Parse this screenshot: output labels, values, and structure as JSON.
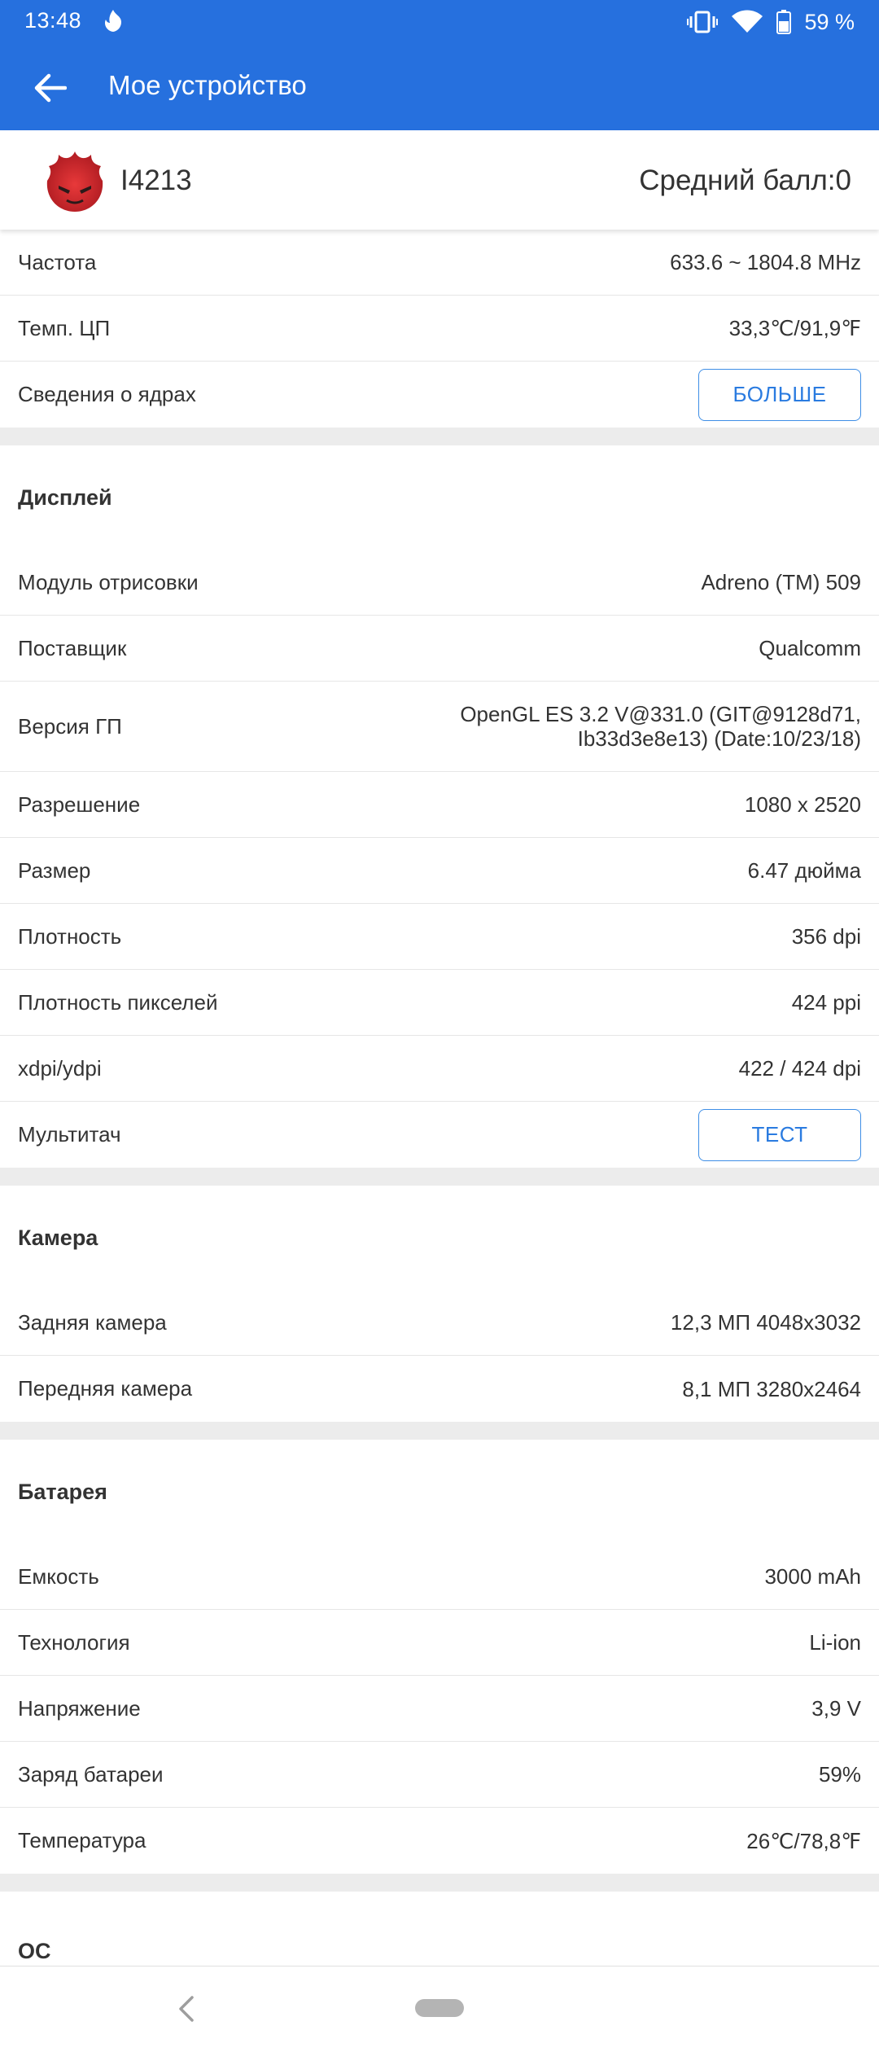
{
  "status_bar": {
    "time": "13:48",
    "battery_percent": "59 %",
    "icons": [
      "vibrate-icon",
      "wifi-icon",
      "battery-icon"
    ]
  },
  "app_bar": {
    "title": "Мое устройство",
    "back_icon": "arrow-back-icon"
  },
  "device": {
    "name": "I4213",
    "score": "Средний балл:0",
    "logo_icon": "antutu-logo-icon"
  },
  "cpu_rows": [
    {
      "label": "Частота",
      "value": "633.6 ~ 1804.8 MHz"
    },
    {
      "label": "Темп. ЦП",
      "value": "33,3℃/91,9℉"
    },
    {
      "label": "Сведения о ядрах",
      "button": "БОЛЬШЕ"
    }
  ],
  "display": {
    "title": "Дисплей",
    "rows": [
      {
        "label": "Модуль отрисовки",
        "value": "Adreno (TM) 509"
      },
      {
        "label": "Поставщик",
        "value": "Qualcomm"
      },
      {
        "label": "Версия ГП",
        "value_line1": "OpenGL ES 3.2 V@331.0 (GIT@9128d71,",
        "value_line2": "Ib33d3e8e13) (Date:10/23/18)"
      },
      {
        "label": "Разрешение",
        "value": "1080 x 2520"
      },
      {
        "label": "Размер",
        "value": "6.47 дюйма"
      },
      {
        "label": "Плотность",
        "value": "356 dpi"
      },
      {
        "label": "Плотность пикселей",
        "value": "424 ppi"
      },
      {
        "label": "xdpi/ydpi",
        "value": "422 / 424 dpi"
      },
      {
        "label": "Мультитач",
        "button": "ТЕСТ"
      }
    ]
  },
  "camera": {
    "title": "Камера",
    "rows": [
      {
        "label": "Задняя камера",
        "value": "12,3 МП 4048x3032"
      },
      {
        "label": "Передняя камера",
        "value": "8,1 МП 3280x2464"
      }
    ]
  },
  "battery": {
    "title": "Батарея",
    "rows": [
      {
        "label": "Емкость",
        "value": "3000 mAh"
      },
      {
        "label": "Технология",
        "value": "Li-ion"
      },
      {
        "label": "Напряжение",
        "value": "3,9 V"
      },
      {
        "label": "Заряд батареи",
        "value": "59%"
      },
      {
        "label": "Температура",
        "value": "26℃/78,8℉"
      }
    ]
  },
  "os": {
    "title": "ОС"
  },
  "colors": {
    "primary": "#2670de",
    "button_text": "#2a7be0",
    "button_border": "#3e8ee6",
    "divider_band": "#ececec"
  }
}
